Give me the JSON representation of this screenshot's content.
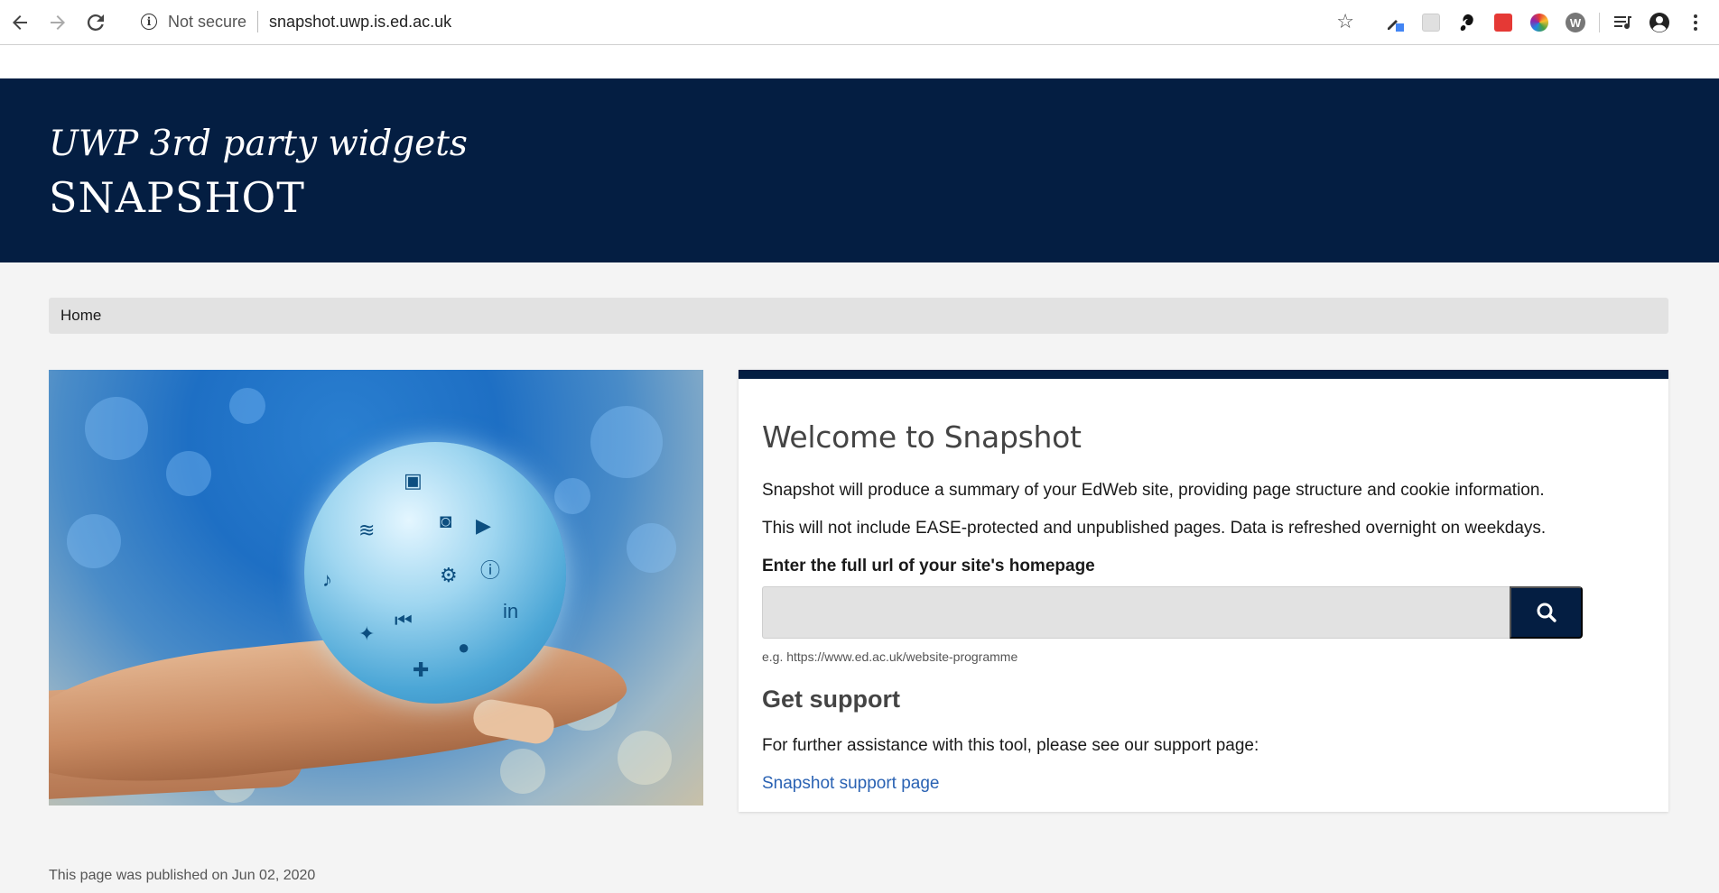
{
  "browser": {
    "security_label": "Not secure",
    "url": "snapshot.uwp.is.ed.ac.uk",
    "colors": {
      "ext_red": "#e53935",
      "ext_blue": "#4285f4"
    }
  },
  "header": {
    "subtitle": "UWP 3rd party widgets",
    "title": "SNAPSHOT",
    "background": "#041e42"
  },
  "breadcrumb": {
    "items": [
      {
        "label": "Home"
      }
    ]
  },
  "main": {
    "welcome_title": "Welcome to Snapshot",
    "intro_1": "Snapshot will produce a summary of your EdWeb site, providing page structure and cookie information.",
    "intro_2": "This will not include EASE-protected and unpublished pages. Data is refreshed overnight on weekdays.",
    "url_label": "Enter the full url of your site's homepage",
    "url_input": {
      "value": "",
      "placeholder": ""
    },
    "url_hint": "e.g. https://www.ed.ac.uk/website-programme",
    "support_title": "Get support",
    "support_text": "For further assistance with this tool, please see our support page:",
    "support_link": "Snapshot support page",
    "link_color": "#2a62b3"
  },
  "footer": {
    "published": "This page was published on Jun 02, 2020"
  }
}
